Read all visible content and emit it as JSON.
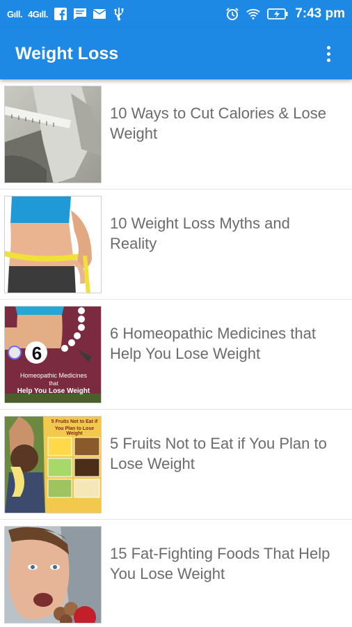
{
  "status_bar": {
    "signal_1": "Gıll.",
    "signal_2": "4Gıll.",
    "time": "7:43 pm"
  },
  "app_bar": {
    "title": "Weight Loss"
  },
  "articles": [
    {
      "title": "10 Ways to Cut Calories & Lose Weight",
      "thumbnail": "measuring-tape-waist-photo"
    },
    {
      "title": "10 Weight Loss Myths and Reality",
      "thumbnail": "waist-measure-blue-top-photo"
    },
    {
      "title": "6 Homeopathic Medicines that Help You Lose Weight",
      "thumbnail": "homeopathic-medicines-poster",
      "thumb_text": {
        "number": "6",
        "line1": "Homeopathic Medicines",
        "line2": "that",
        "line3": "Help You Lose Weight"
      }
    },
    {
      "title": "5 Fruits Not to Eat if You Plan to Lose Weight",
      "thumbnail": "fruits-collage-poster",
      "thumb_text": {
        "line1": "5 Fruits Not to Eat if",
        "line2": "You Plan to Lose Weight"
      }
    },
    {
      "title": "15 Fat-Fighting Foods That Help You Lose Weight",
      "thumbnail": "man-eating-food-photo"
    }
  ],
  "colors": {
    "primary": "#1e88e5",
    "title_text": "#6b6b6b",
    "divider": "#e6e6e6"
  }
}
